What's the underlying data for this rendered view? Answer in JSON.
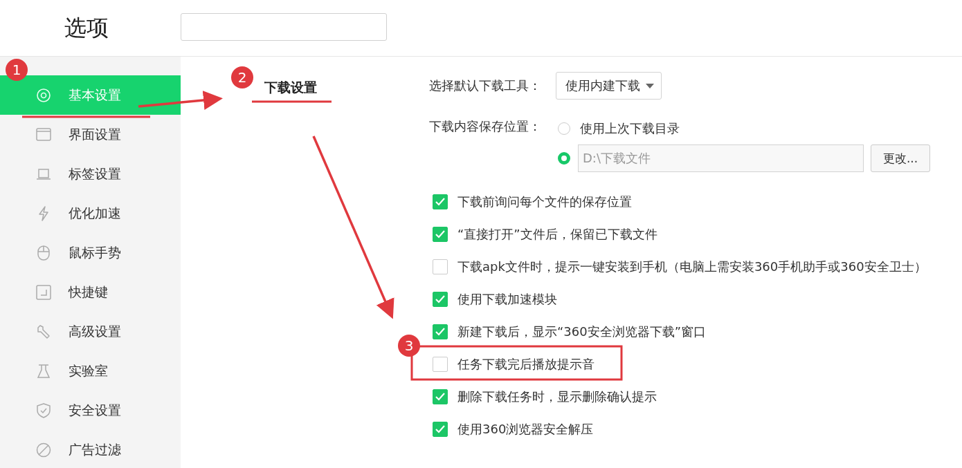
{
  "window": {
    "title": "选项"
  },
  "sidebar": {
    "items": [
      {
        "label": "基本设置",
        "selected": true
      },
      {
        "label": "界面设置",
        "selected": false
      },
      {
        "label": "标签设置",
        "selected": false
      },
      {
        "label": "优化加速",
        "selected": false
      },
      {
        "label": "鼠标手势",
        "selected": false
      },
      {
        "label": "快捷键",
        "selected": false
      },
      {
        "label": "高级设置",
        "selected": false
      },
      {
        "label": "实验室",
        "selected": false
      },
      {
        "label": "安全设置",
        "selected": false
      },
      {
        "label": "广告过滤",
        "selected": false
      }
    ]
  },
  "tabs": [
    {
      "label": "下载设置",
      "selected": true
    }
  ],
  "default_tool": {
    "label": "选择默认下载工具：",
    "value": "使用内建下载"
  },
  "save_location": {
    "label": "下载内容保存位置：",
    "options": [
      {
        "kind": "text",
        "label": "使用上次下载目录",
        "selected": false
      },
      {
        "kind": "path",
        "value": "D:\\下载文件",
        "selected": true
      }
    ],
    "button": "更改..."
  },
  "options": [
    {
      "label": "下载前询问每个文件的保存位置",
      "checked": true
    },
    {
      "label": "“直接打开”文件后，保留已下载文件",
      "checked": true
    },
    {
      "label": "下载apk文件时，提示一键安装到手机（电脑上需安装360手机助手或360安全卫士）",
      "checked": false
    },
    {
      "label": "使用下载加速模块",
      "checked": true
    },
    {
      "label": "新建下载后，显示“360安全浏览器下载”窗口",
      "checked": true
    },
    {
      "label": "任务下载完后播放提示音",
      "checked": false
    },
    {
      "label": "删除下载任务时，显示删除确认提示",
      "checked": true
    },
    {
      "label": "使用360浏览器安全解压",
      "checked": true
    }
  ],
  "annotations": [
    {
      "number": "1"
    },
    {
      "number": "2"
    },
    {
      "number": "3"
    }
  ]
}
